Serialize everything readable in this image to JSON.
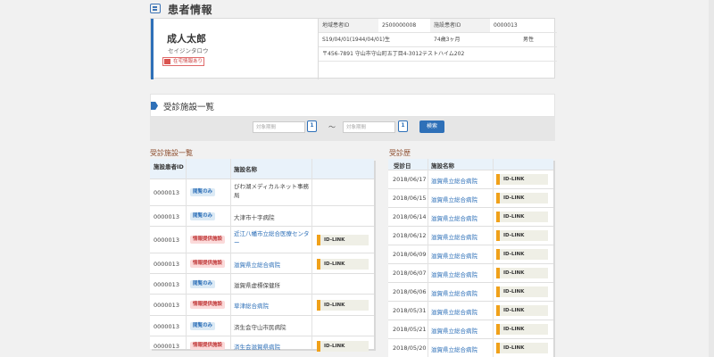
{
  "page_title": "患者情報",
  "patient": {
    "name": "成人太郎",
    "kana": "セイジンタロウ",
    "badge": "在宅情報あり",
    "region_id_label": "地域患者ID",
    "region_id": "2500000008",
    "facility_id_label": "施設患者ID",
    "facility_id": "0000013",
    "birth": "S19/04/01(1944/04/01)生",
    "age": "74歳3ヶ月",
    "sex": "男性",
    "address": "〒456-7891 守山市守山町五丁目4-3012テストハイム202"
  },
  "section_title": "受診施設一覧",
  "filter": {
    "from_placeholder": "対象期間",
    "to_placeholder": "対象期間",
    "tilde": "〜",
    "search_label": "検索",
    "cal_label": "1"
  },
  "facility_list": {
    "title": "受診施設一覧",
    "headers": [
      "施設患者ID",
      "",
      "施設名称",
      ""
    ],
    "rows": [
      {
        "id": "0000013",
        "tag": "閲覧のみ",
        "tag_type": "view",
        "name": "びわ湖メディカルネット事務局",
        "link": false,
        "idlink": ""
      },
      {
        "id": "0000013",
        "tag": "閲覧のみ",
        "tag_type": "view",
        "name": "大津市十字病院",
        "link": false,
        "idlink": ""
      },
      {
        "id": "0000013",
        "tag": "情報提供施設",
        "tag_type": "provide",
        "name": "近江八幡市立総合医療センター",
        "link": true,
        "idlink": "ID-LINK"
      },
      {
        "id": "0000013",
        "tag": "情報提供施設",
        "tag_type": "provide",
        "name": "滋賀県立総合病院",
        "link": true,
        "idlink": "ID-LINK"
      },
      {
        "id": "0000013",
        "tag": "閲覧のみ",
        "tag_type": "view",
        "name": "滋賀県虚標保健所",
        "link": false,
        "idlink": ""
      },
      {
        "id": "0000013",
        "tag": "情報提供施設",
        "tag_type": "provide",
        "name": "草津総合病院",
        "link": true,
        "idlink": "ID-LINK"
      },
      {
        "id": "0000013",
        "tag": "閲覧のみ",
        "tag_type": "view",
        "name": "済生会守山市民病院",
        "link": false,
        "idlink": ""
      },
      {
        "id": "0000013",
        "tag": "情報提供施設",
        "tag_type": "provide",
        "name": "済生会滋賀県病院",
        "link": true,
        "idlink": "ID-LINK"
      }
    ]
  },
  "history": {
    "title": "受診歴",
    "headers": [
      "受診日",
      "施設名称",
      ""
    ],
    "rows": [
      {
        "date": "2018/06/17",
        "name": "滋賀県立総合病院",
        "idlink": "ID-LINK"
      },
      {
        "date": "2018/06/15",
        "name": "滋賀県立総合病院",
        "idlink": "ID-LINK"
      },
      {
        "date": "2018/06/14",
        "name": "滋賀県立総合病院",
        "idlink": "ID-LINK"
      },
      {
        "date": "2018/06/12",
        "name": "滋賀県立総合病院",
        "idlink": "ID-LINK"
      },
      {
        "date": "2018/06/09",
        "name": "滋賀県立総合病院",
        "idlink": "ID-LINK"
      },
      {
        "date": "2018/06/07",
        "name": "滋賀県立総合病院",
        "idlink": "ID-LINK"
      },
      {
        "date": "2018/06/06",
        "name": "滋賀県立総合病院",
        "idlink": "ID-LINK"
      },
      {
        "date": "2018/05/31",
        "name": "滋賀県立総合病院",
        "idlink": "ID-LINK"
      },
      {
        "date": "2018/05/21",
        "name": "滋賀県立総合病院",
        "idlink": "ID-LINK"
      },
      {
        "date": "2018/05/20",
        "name": "滋賀県立総合病院",
        "idlink": "ID-LINK"
      }
    ]
  }
}
